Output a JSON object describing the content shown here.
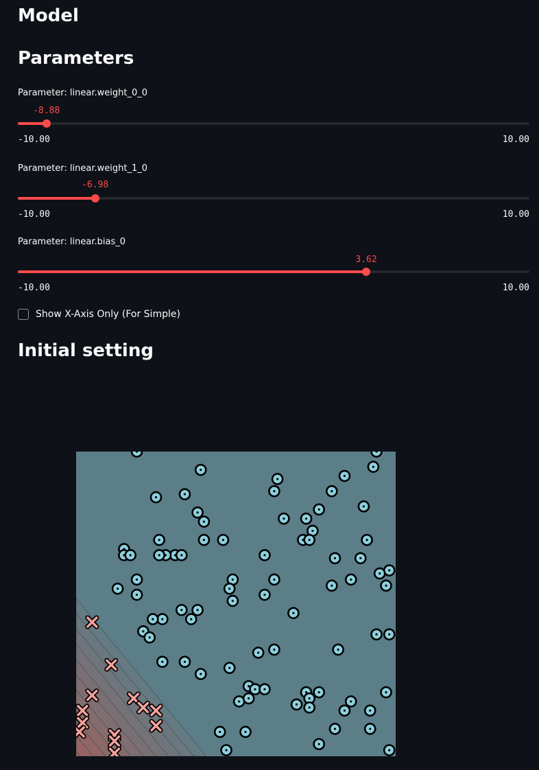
{
  "headings": {
    "model": "Model",
    "parameters": "Parameters",
    "initial_setting": "Initial setting"
  },
  "sliders": [
    {
      "label": "Parameter: linear.weight_0_0",
      "value": -8.88,
      "value_text": "-8.88",
      "min": -10,
      "max": 10,
      "min_text": "-10.00",
      "max_text": "10.00"
    },
    {
      "label": "Parameter: linear.weight_1_0",
      "value": -6.98,
      "value_text": "-6.98",
      "min": -10,
      "max": 10,
      "min_text": "-10.00",
      "max_text": "10.00"
    },
    {
      "label": "Parameter: linear.bias_0",
      "value": 3.62,
      "value_text": "3.62",
      "min": -10,
      "max": 10,
      "min_text": "-10.00",
      "max_text": "10.00"
    }
  ],
  "checkbox": {
    "label": "Show X-Axis Only (For Simple)",
    "checked": false
  },
  "colors": {
    "accent": "#ff4b4b",
    "background": "#0e1117",
    "region_positive": "#5b7e88",
    "region_negative": "#9b625f",
    "point_positive": "#8ecfdc",
    "point_negative": "#f3a19c"
  },
  "chart_data": {
    "type": "scatter",
    "title": "",
    "xlabel": "",
    "ylabel": "",
    "xlim": [
      0,
      1
    ],
    "ylim": [
      0,
      1
    ],
    "grid": false,
    "decision_boundary": {
      "w0": -8.88,
      "w1": -6.98,
      "b": 3.62
    },
    "series": [
      {
        "marker": "circle",
        "class": "positive",
        "points": [
          [
            0.19,
            1.0
          ],
          [
            0.39,
            0.94
          ],
          [
            0.63,
            0.91
          ],
          [
            0.94,
            1.0
          ],
          [
            0.93,
            0.95
          ],
          [
            0.84,
            0.92
          ],
          [
            0.8,
            0.87
          ],
          [
            0.25,
            0.85
          ],
          [
            0.34,
            0.86
          ],
          [
            0.62,
            0.87
          ],
          [
            0.9,
            0.82
          ],
          [
            0.38,
            0.8
          ],
          [
            0.4,
            0.77
          ],
          [
            0.76,
            0.81
          ],
          [
            0.72,
            0.78
          ],
          [
            0.65,
            0.78
          ],
          [
            0.26,
            0.71
          ],
          [
            0.4,
            0.71
          ],
          [
            0.46,
            0.71
          ],
          [
            0.74,
            0.74
          ],
          [
            0.71,
            0.71
          ],
          [
            0.73,
            0.71
          ],
          [
            0.91,
            0.71
          ],
          [
            0.15,
            0.68
          ],
          [
            0.15,
            0.66
          ],
          [
            0.17,
            0.66
          ],
          [
            0.31,
            0.66
          ],
          [
            0.28,
            0.66
          ],
          [
            0.33,
            0.66
          ],
          [
            0.26,
            0.66
          ],
          [
            0.59,
            0.66
          ],
          [
            0.89,
            0.65
          ],
          [
            0.81,
            0.65
          ],
          [
            0.98,
            0.61
          ],
          [
            0.49,
            0.58
          ],
          [
            0.62,
            0.58
          ],
          [
            0.86,
            0.58
          ],
          [
            0.95,
            0.6
          ],
          [
            0.97,
            0.56
          ],
          [
            0.13,
            0.55
          ],
          [
            0.19,
            0.58
          ],
          [
            0.19,
            0.53
          ],
          [
            0.48,
            0.55
          ],
          [
            0.59,
            0.53
          ],
          [
            0.8,
            0.56
          ],
          [
            0.38,
            0.48
          ],
          [
            0.33,
            0.48
          ],
          [
            0.36,
            0.45
          ],
          [
            0.49,
            0.51
          ],
          [
            0.68,
            0.47
          ],
          [
            0.27,
            0.45
          ],
          [
            0.24,
            0.45
          ],
          [
            0.21,
            0.41
          ],
          [
            0.23,
            0.39
          ],
          [
            0.94,
            0.4
          ],
          [
            0.98,
            0.4
          ],
          [
            0.82,
            0.35
          ],
          [
            0.62,
            0.35
          ],
          [
            0.57,
            0.34
          ],
          [
            0.34,
            0.31
          ],
          [
            0.27,
            0.31
          ],
          [
            0.39,
            0.27
          ],
          [
            0.48,
            0.29
          ],
          [
            0.54,
            0.23
          ],
          [
            0.56,
            0.22
          ],
          [
            0.59,
            0.22
          ],
          [
            0.72,
            0.21
          ],
          [
            0.76,
            0.21
          ],
          [
            0.73,
            0.19
          ],
          [
            0.97,
            0.21
          ],
          [
            0.51,
            0.18
          ],
          [
            0.54,
            0.19
          ],
          [
            0.69,
            0.17
          ],
          [
            0.73,
            0.16
          ],
          [
            0.84,
            0.15
          ],
          [
            0.86,
            0.18
          ],
          [
            0.92,
            0.15
          ],
          [
            0.81,
            0.09
          ],
          [
            0.53,
            0.08
          ],
          [
            0.45,
            0.08
          ],
          [
            0.92,
            0.09
          ],
          [
            0.47,
            0.02
          ],
          [
            0.76,
            0.04
          ],
          [
            0.98,
            0.02
          ]
        ]
      },
      {
        "marker": "x",
        "class": "negative",
        "points": [
          [
            0.05,
            0.44
          ],
          [
            0.11,
            0.3
          ],
          [
            0.05,
            0.2
          ],
          [
            0.18,
            0.19
          ],
          [
            0.21,
            0.16
          ],
          [
            0.25,
            0.15
          ],
          [
            0.02,
            0.15
          ],
          [
            0.02,
            0.11
          ],
          [
            0.01,
            0.08
          ],
          [
            0.12,
            0.07
          ],
          [
            0.12,
            0.05
          ],
          [
            0.12,
            0.01
          ],
          [
            0.25,
            0.1
          ]
        ]
      }
    ]
  }
}
